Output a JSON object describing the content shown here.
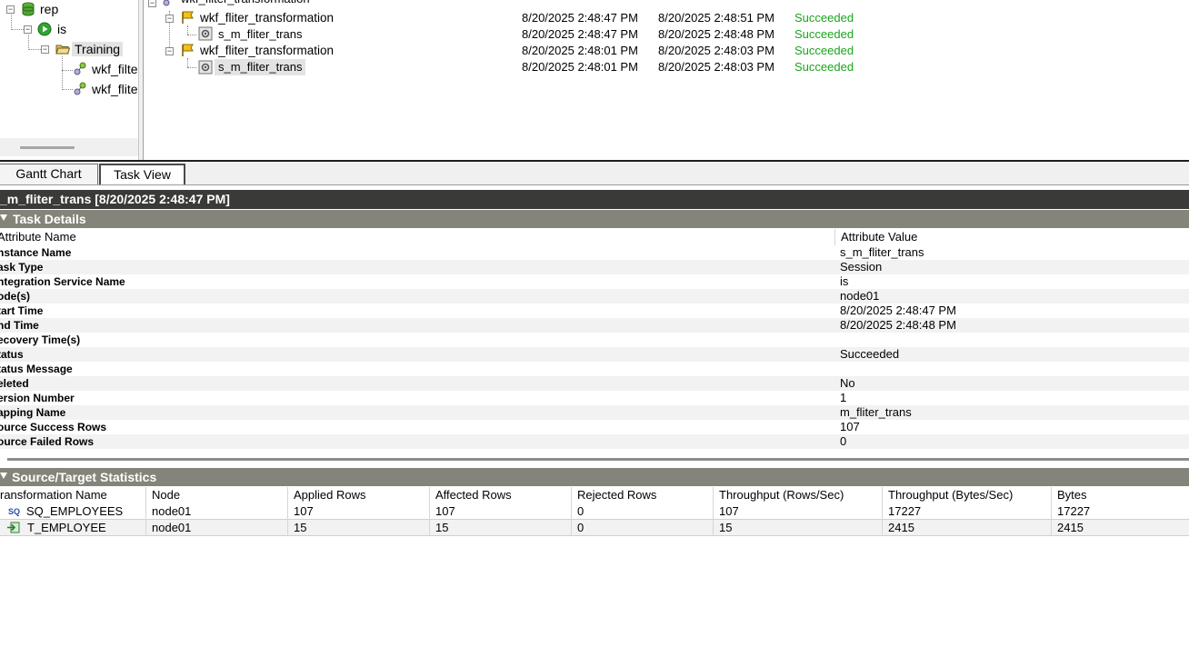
{
  "navigator": {
    "repository": "rep",
    "integration_service": "is",
    "folder": "Training",
    "workflows": [
      "wkf_filte",
      "wkf_flite"
    ]
  },
  "run_tree": {
    "root": "wkf_filter_transformation",
    "runs": [
      {
        "name": "wkf_fliter_transformation",
        "type": "workflow",
        "start": "8/20/2025 2:48:47 PM",
        "end": "8/20/2025 2:48:51 PM",
        "status": "Succeeded"
      },
      {
        "name": "s_m_fliter_trans",
        "type": "session",
        "start": "8/20/2025 2:48:47 PM",
        "end": "8/20/2025 2:48:48 PM",
        "status": "Succeeded"
      },
      {
        "name": "wkf_fliter_transformation",
        "type": "workflow",
        "start": "8/20/2025 2:48:01 PM",
        "end": "8/20/2025 2:48:03 PM",
        "status": "Succeeded"
      },
      {
        "name": "s_m_fliter_trans",
        "type": "session",
        "start": "8/20/2025 2:48:01 PM",
        "end": "8/20/2025 2:48:03 PM",
        "status": "Succeeded",
        "selected": true
      }
    ]
  },
  "tabs": [
    "Gantt Chart",
    "Task View"
  ],
  "details": {
    "title": "_m_fliter_trans [8/20/2025 2:48:47 PM]",
    "task_section": "Task Details",
    "attr_header": [
      "Attribute Name",
      "Attribute Value"
    ],
    "attributes": [
      {
        "name": "nstance Name",
        "value": "s_m_fliter_trans"
      },
      {
        "name": "ask Type",
        "value": "Session"
      },
      {
        "name": "ntegration Service Name",
        "value": "is"
      },
      {
        "name": "ode(s)",
        "value": "node01"
      },
      {
        "name": "tart Time",
        "value": "8/20/2025 2:48:47 PM"
      },
      {
        "name": "nd Time",
        "value": "8/20/2025 2:48:48 PM"
      },
      {
        "name": "ecovery Time(s)",
        "value": ""
      },
      {
        "name": "tatus",
        "value": "Succeeded"
      },
      {
        "name": "tatus Message",
        "value": ""
      },
      {
        "name": "eleted",
        "value": "No"
      },
      {
        "name": "ersion Number",
        "value": "1"
      },
      {
        "name": "apping Name",
        "value": "m_fliter_trans"
      },
      {
        "name": "ource Success Rows",
        "value": "107"
      },
      {
        "name": "ource Failed Rows",
        "value": "0"
      }
    ],
    "stats_section": "Source/Target Statistics",
    "stats_header": [
      "ransformation Name",
      "Node",
      "Applied Rows",
      "Affected Rows",
      "Rejected Rows",
      "Throughput (Rows/Sec)",
      "Throughput (Bytes/Sec)",
      "Bytes"
    ],
    "stats_rows": [
      {
        "icon": "source-qualifier-icon",
        "cells": [
          "SQ_EMPLOYEES",
          "node01",
          "107",
          "107",
          "0",
          "107",
          "17227",
          "17227"
        ]
      },
      {
        "icon": "target-icon",
        "cells": [
          "T_EMPLOYEE",
          "node01",
          "15",
          "15",
          "0",
          "15",
          "2415",
          "2415"
        ]
      }
    ]
  },
  "colors": {
    "succeeded": "#1aa51a",
    "title_bar": "#3a3a38",
    "section_bar": "#85847a"
  }
}
